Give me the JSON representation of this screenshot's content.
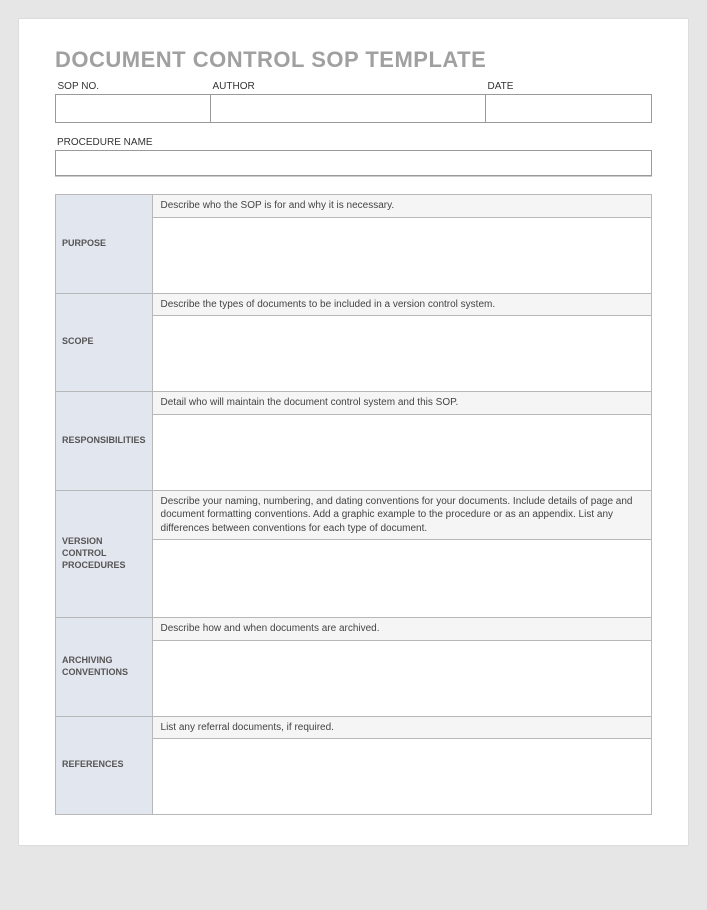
{
  "title": "DOCUMENT CONTROL SOP TEMPLATE",
  "meta": {
    "sop_no_label": "SOP NO.",
    "author_label": "AUTHOR",
    "date_label": "DATE",
    "sop_no": "",
    "author": "",
    "date": ""
  },
  "procedure": {
    "label": "PROCEDURE NAME",
    "value": ""
  },
  "sections": [
    {
      "label": "PURPOSE",
      "prompt": "Describe who the SOP is for and why it is necessary."
    },
    {
      "label": "SCOPE",
      "prompt": "Describe the types of documents to be included in a version control system."
    },
    {
      "label": "RESPONSIBILITIES",
      "prompt": "Detail who will maintain the document control system and this SOP."
    },
    {
      "label": "VERSION CONTROL PROCEDURES",
      "prompt": "Describe your naming, numbering, and dating conventions for your documents. Include details of page and document formatting conventions.  Add a graphic example to the procedure or as an appendix. List any differences between conventions for each type of document."
    },
    {
      "label": "ARCHIVING CONVENTIONS",
      "prompt": "Describe how and when documents are archived."
    },
    {
      "label": "REFERENCES",
      "prompt": "List any referral documents, if required."
    }
  ]
}
